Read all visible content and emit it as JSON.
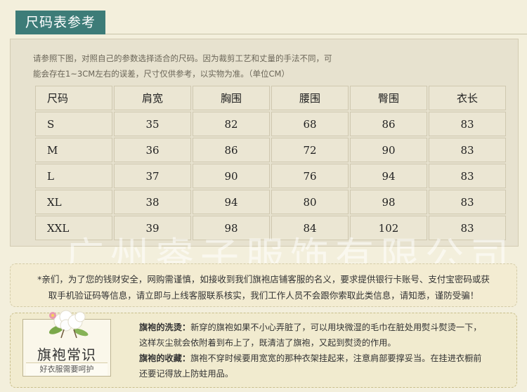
{
  "header": {
    "title": "尺码表参考"
  },
  "intro": {
    "line1": "请参照下图，对照自己的参数选择适合的尺码。因为裁剪工艺和丈量的手法不同，可",
    "line2": "能会存在1~3CM左右的误差，尺寸仅供参考，以实物为准。（单位CM）"
  },
  "table": {
    "headers": [
      "尺码",
      "肩宽",
      "胸围",
      "腰围",
      "臀围",
      "衣长"
    ],
    "rows": [
      [
        "S",
        "35",
        "82",
        "68",
        "86",
        "83"
      ],
      [
        "M",
        "36",
        "86",
        "72",
        "90",
        "83"
      ],
      [
        "L",
        "37",
        "90",
        "76",
        "94",
        "83"
      ],
      [
        "XL",
        "38",
        "94",
        "80",
        "98",
        "83"
      ],
      [
        "XXL",
        "39",
        "98",
        "84",
        "102",
        "83"
      ]
    ]
  },
  "watermark": "广州睿子服饰有限公司",
  "notice": {
    "line1": "*亲们，为了您的钱财安全，网购需谨慎，如接收到我们旗袍店铺客服的名义，要求提供银行卡账号、支付宝密码或获",
    "line2": "取手机验证码等信息，请立即与上线客服联系核实，我们工作人员不会跟你索取此类信息，请知悉，谨防受骗！"
  },
  "care": {
    "card_title": "旗袍常识",
    "card_subtitle": "好衣服需要呵护",
    "wash_head": "旗袍的洗烫：",
    "wash_text": "新穿的旗袍如果不小心弄脏了，可以用块微湿的毛巾在脏处用熨斗熨烫一下，",
    "wash_text2": "这样灰尘就会依附着到布上了，既清洁了旗袍，又起到熨烫的作用。",
    "store_head": "旗袍的收藏：",
    "store_text": "旗袍不穿时候要用宽宽的那种衣架挂起来，注意肩部要撑妥当。在挂进衣橱前",
    "store_text2": "还要记得放上防蛀用品。"
  },
  "icons": {
    "card_decoration": "cotton-flower-icon"
  }
}
